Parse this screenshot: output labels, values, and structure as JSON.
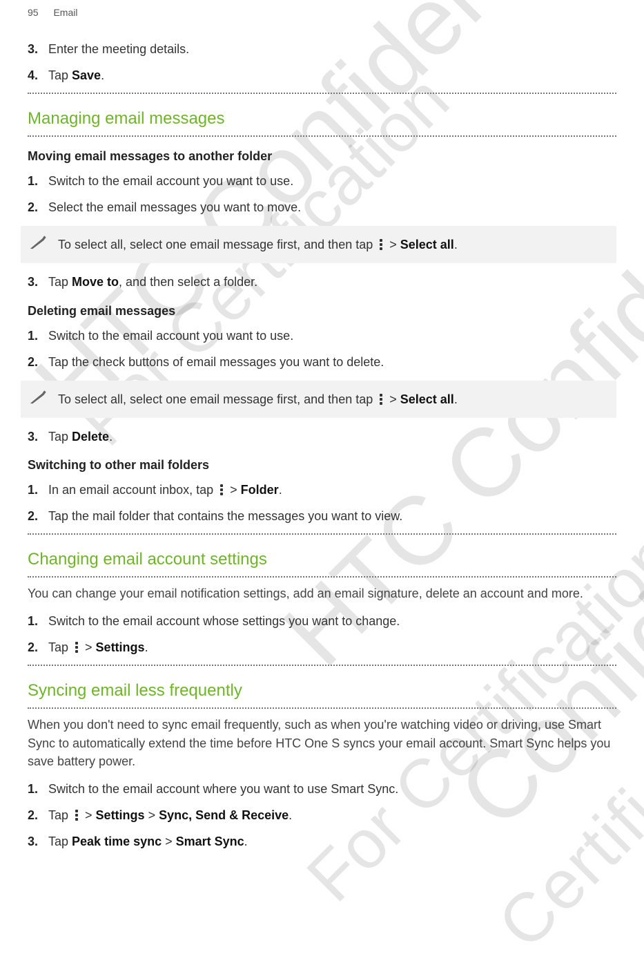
{
  "header": {
    "page": "95",
    "section": "Email"
  },
  "wm": {
    "conf": "HTC Confidential",
    "cert": "For Certification",
    "confShort": "Confide",
    "certShort": "Certifi"
  },
  "top": {
    "s3": "Enter the meeting details.",
    "s4a": "Tap ",
    "s4b": "Save",
    "s4c": "."
  },
  "managing": {
    "title": "Managing email messages",
    "moving": {
      "head": "Moving email messages to another folder",
      "s1": "Switch to the email account you want to use.",
      "s2": "Select the email messages you want to move.",
      "tipA": "To select all, select one email message first, and then tap ",
      "tipB": " > ",
      "tipC": "Select all",
      "tipD": ".",
      "s3a": "Tap ",
      "s3b": "Move to",
      "s3c": ", and then select a folder."
    },
    "deleting": {
      "head": "Deleting email messages",
      "s1": "Switch to the email account you want to use.",
      "s2": "Tap the check buttons of email messages you want to delete.",
      "tipA": "To select all, select one email message first, and then tap ",
      "tipB": " > ",
      "tipC": "Select all",
      "tipD": ".",
      "s3a": "Tap ",
      "s3b": "Delete",
      "s3c": "."
    },
    "switching": {
      "head": "Switching to other mail folders",
      "s1a": "In an email account inbox, tap ",
      "s1b": " > ",
      "s1c": "Folder",
      "s1d": ".",
      "s2": "Tap the mail folder that contains the messages you want to view."
    }
  },
  "changing": {
    "title": "Changing email account settings",
    "intro": "You can change your email notification settings, add an email signature, delete an account and more.",
    "s1": "Switch to the email account whose settings you want to change.",
    "s2a": "Tap ",
    "s2b": " > ",
    "s2c": "Settings",
    "s2d": "."
  },
  "syncing": {
    "title": "Syncing email less frequently",
    "intro": "When you don't need to sync email frequently, such as when you're watching video or driving, use Smart Sync to automatically extend the time before HTC One S syncs your email account. Smart Sync helps you save battery power.",
    "s1": "Switch to the email account where you want to use Smart Sync.",
    "s2a": "Tap ",
    "s2b": " > ",
    "s2c": "Settings",
    "s2d": " > ",
    "s2e": "Sync, Send & Receive",
    "s2f": ".",
    "s3a": "Tap ",
    "s3b": "Peak time sync",
    "s3c": " > ",
    "s3d": "Smart Sync",
    "s3e": "."
  }
}
